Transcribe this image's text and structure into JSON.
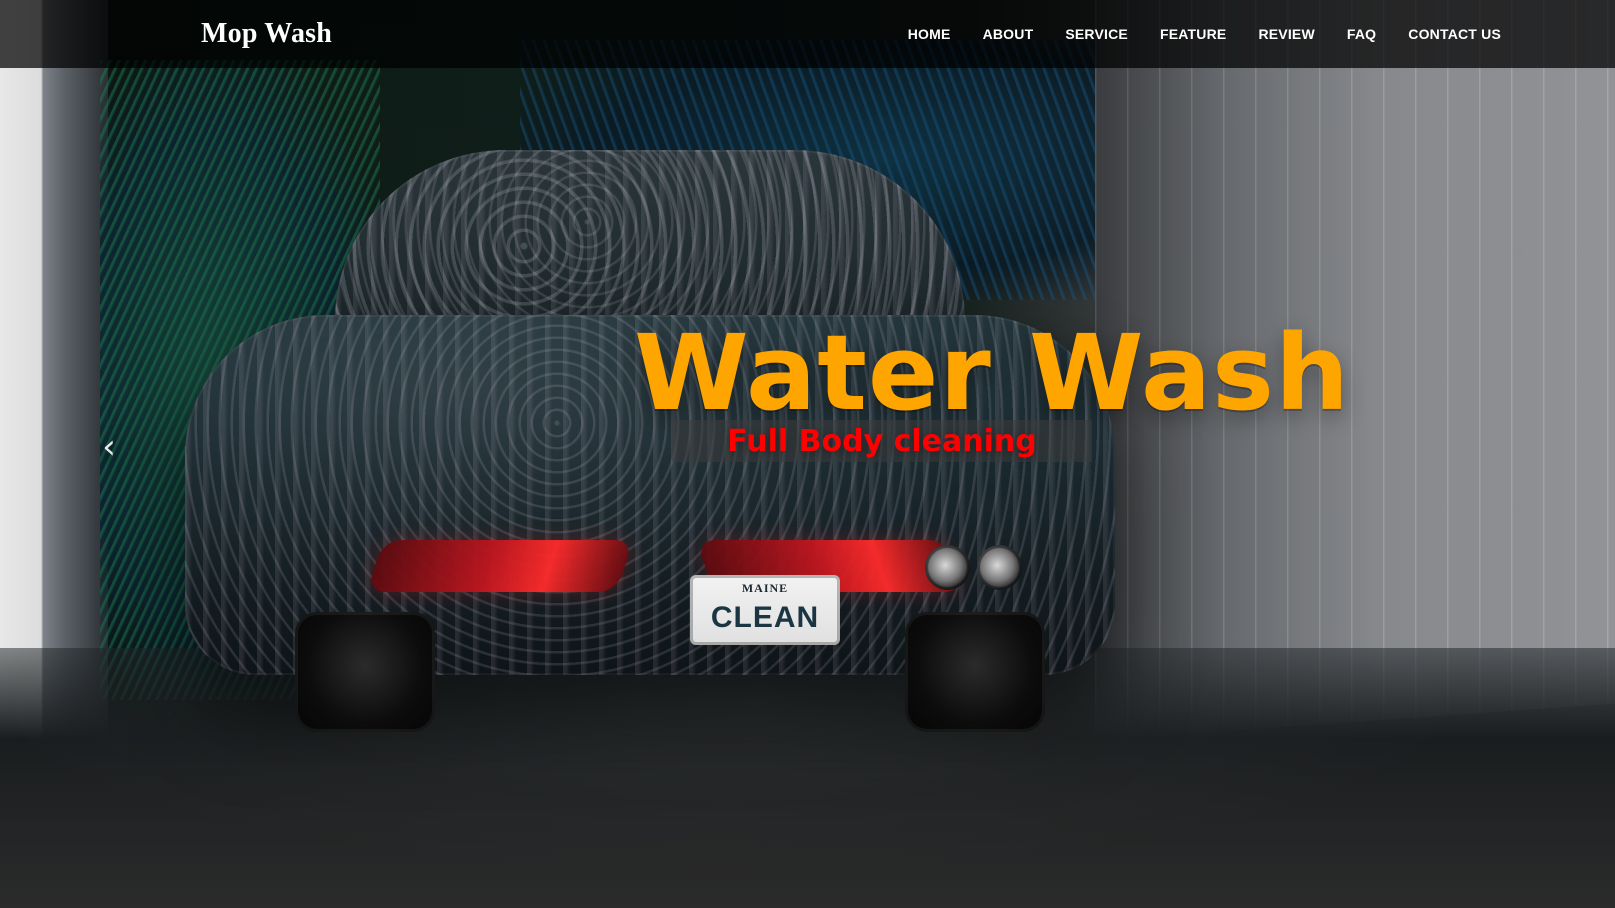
{
  "brand": {
    "name": "Mop Wash"
  },
  "nav": {
    "items": [
      {
        "label": "HOME"
      },
      {
        "label": "ABOUT"
      },
      {
        "label": "SERVICE"
      },
      {
        "label": "FEATURE"
      },
      {
        "label": "REVIEW"
      },
      {
        "label": "FAQ"
      },
      {
        "label": "CONTACT US"
      }
    ]
  },
  "hero": {
    "title": "Water Wash",
    "subtitle": "Full Body cleaning",
    "title_color": "#ffa500",
    "subtitle_color": "#ff0000",
    "background_overlay_color": "#000000"
  },
  "carousel": {
    "prev_icon": "chevron-left-icon"
  },
  "plate": {
    "state": "MAINE",
    "main": "CLEAN"
  }
}
